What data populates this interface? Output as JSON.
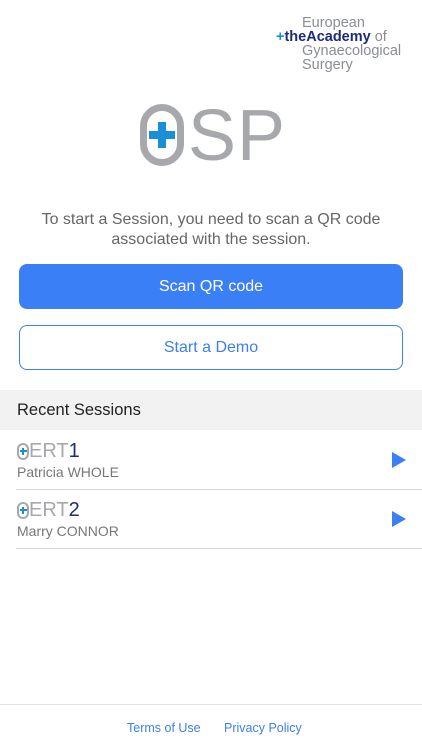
{
  "partner_logo": {
    "line1": "European",
    "plus": "+",
    "the": "the",
    "academy": "Academy",
    "of": " of",
    "line3": "Gynaecological",
    "line4": "Surgery"
  },
  "app_logo": {
    "text": "SP"
  },
  "instructions": "To start a Session, you need to scan a QR code associated with the session.",
  "buttons": {
    "scan": "Scan QR code",
    "demo": "Start a Demo"
  },
  "recent": {
    "title": "Recent Sessions",
    "items": [
      {
        "code_prefix": "ERT",
        "code_number": "1",
        "name": "Patricia WHOLE"
      },
      {
        "code_prefix": "ERT",
        "code_number": "2",
        "name": "Marry CONNOR"
      }
    ]
  },
  "footer": {
    "terms": "Terms of Use",
    "privacy": "Privacy Policy"
  },
  "colors": {
    "accent": "#3a7ff5",
    "logo_gray": "#a6a8ab",
    "logo_blue": "#1a8fd8",
    "navy": "#1e2a7a"
  }
}
